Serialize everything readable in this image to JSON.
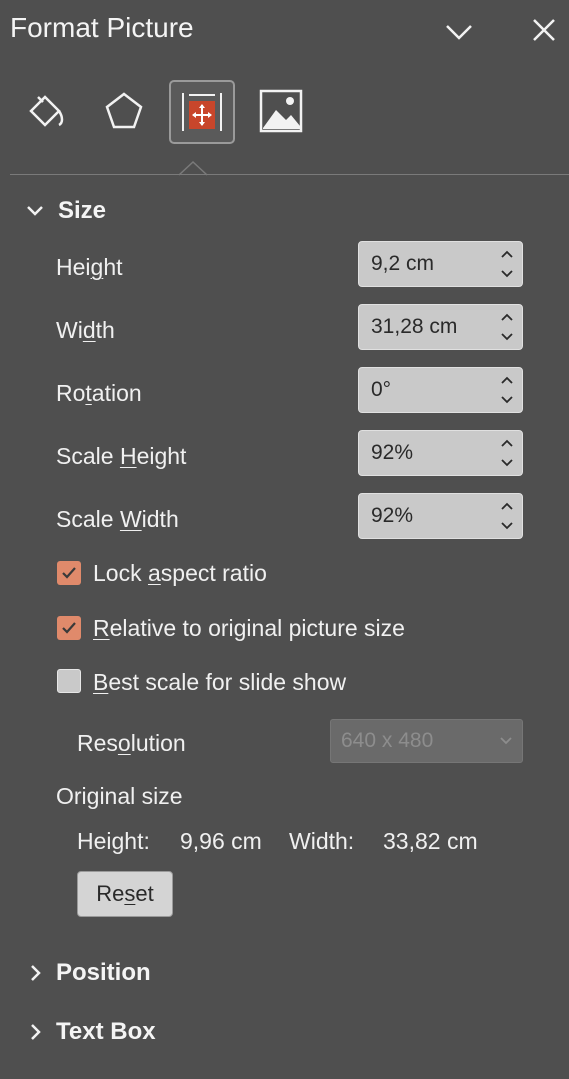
{
  "header": {
    "title": "Format Picture",
    "collapse_icon": "chevron-down-icon",
    "close_icon": "close-icon"
  },
  "tabs": [
    {
      "name": "fill-line",
      "icon": "paint-bucket-icon",
      "active": false
    },
    {
      "name": "effects",
      "icon": "pentagon-icon",
      "active": false
    },
    {
      "name": "size-properties",
      "icon": "size-properties-icon",
      "active": true
    },
    {
      "name": "picture",
      "icon": "picture-icon",
      "active": false
    }
  ],
  "size": {
    "title": "Size",
    "height": {
      "label_pre": "Hei",
      "label_u": "g",
      "label_post": "ht",
      "value": "9,2 cm"
    },
    "width": {
      "label_pre": "Wi",
      "label_u": "d",
      "label_post": "th",
      "value": "31,28 cm"
    },
    "rotation": {
      "label_pre": "Ro",
      "label_u": "t",
      "label_post": "ation",
      "value": "0°"
    },
    "scale_height": {
      "label_pre": "Scale ",
      "label_u": "H",
      "label_post": "eight",
      "value": "92%"
    },
    "scale_width": {
      "label_pre": "Scale ",
      "label_u": "W",
      "label_post": "idth",
      "value": "92%"
    },
    "lock_aspect": {
      "label_pre": "Lock ",
      "label_u": "a",
      "label_post": "spect ratio",
      "checked": true
    },
    "relative_original": {
      "label_pre": "",
      "label_u": "R",
      "label_post": "elative to original picture size",
      "checked": true
    },
    "best_scale": {
      "label_pre": "",
      "label_u": "B",
      "label_post": "est scale for slide show",
      "checked": false
    },
    "resolution": {
      "label_pre": "Res",
      "label_u": "o",
      "label_post": "lution",
      "value": "640 x 480"
    },
    "original_size": {
      "label": "Original size",
      "height_label": "Height:",
      "height_value": "9,96 cm",
      "width_label": "Width:",
      "width_value": "33,82 cm"
    },
    "reset": {
      "label_pre": "Re",
      "label_u": "s",
      "label_post": "et"
    }
  },
  "sections": {
    "position": "Position",
    "text_box": "Text Box"
  },
  "colors": {
    "background": "#4f4f4f",
    "checkbox_accent": "#e08a6b",
    "active_tab_icon": "#c8462b"
  }
}
